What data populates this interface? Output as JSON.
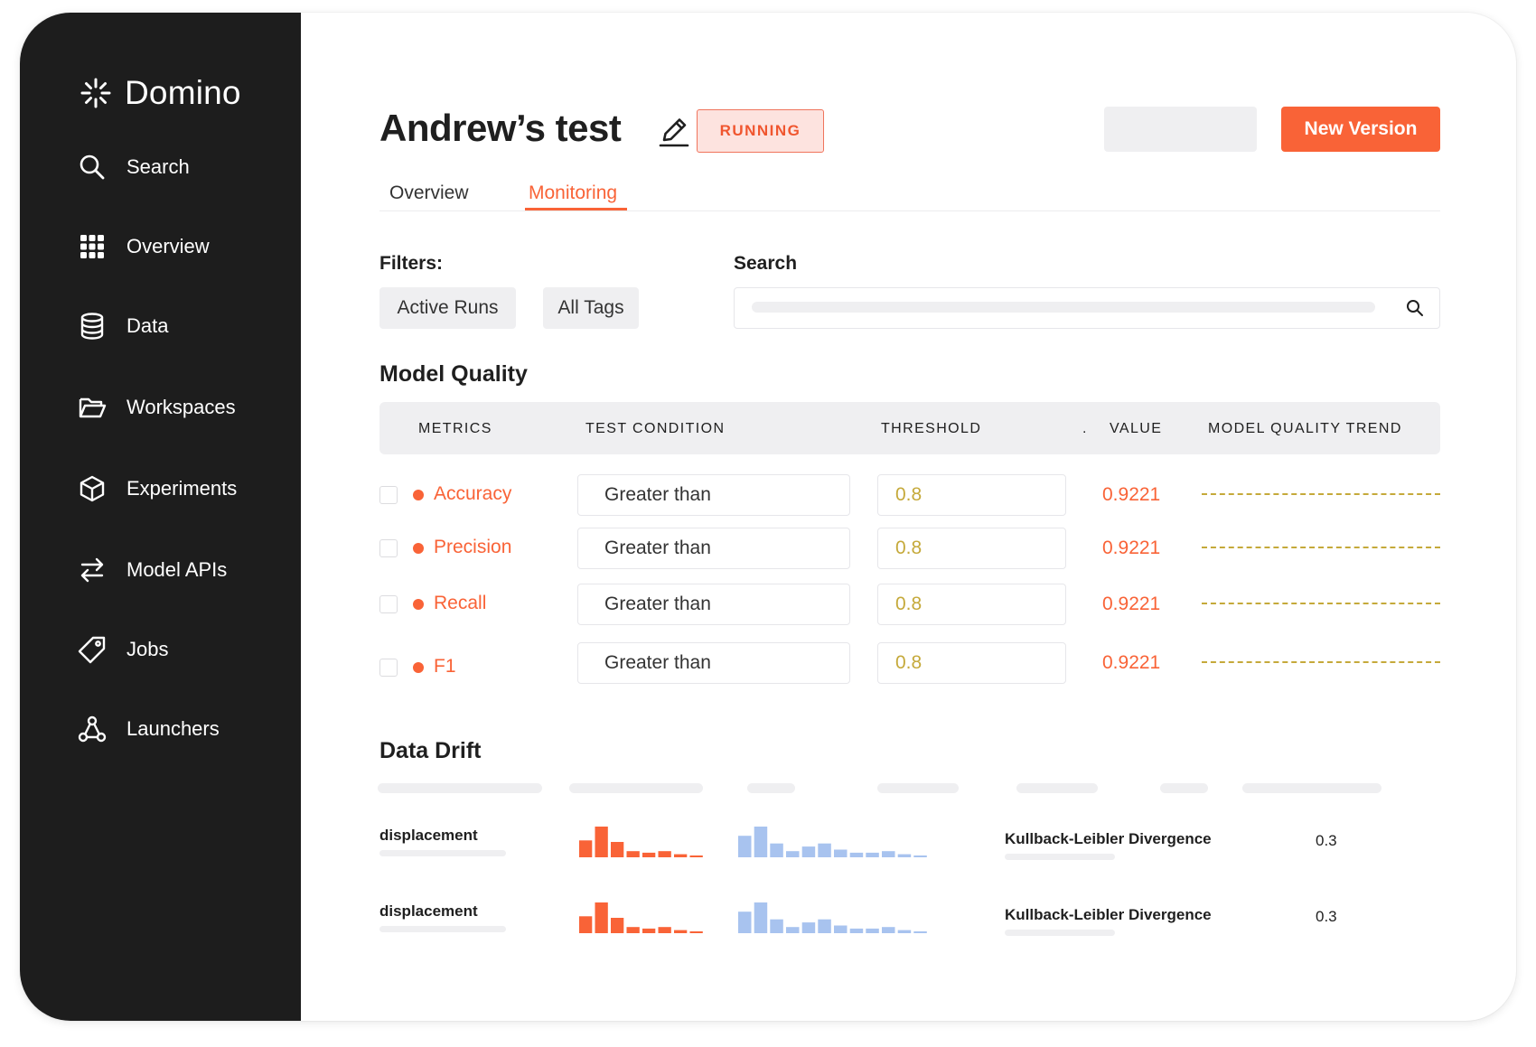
{
  "app": {
    "name": "Domino"
  },
  "sidebar": {
    "items": [
      {
        "label": "Search",
        "icon": "search-icon"
      },
      {
        "label": "Overview",
        "icon": "grid-icon"
      },
      {
        "label": "Data",
        "icon": "database-icon"
      },
      {
        "label": "Workspaces",
        "icon": "folder-icon"
      },
      {
        "label": "Experiments",
        "icon": "cube-icon"
      },
      {
        "label": "Model APIs",
        "icon": "swap-arrows-icon"
      },
      {
        "label": "Jobs",
        "icon": "tag-icon"
      },
      {
        "label": "Launchers",
        "icon": "network-icon"
      }
    ]
  },
  "header": {
    "title": "Andrew’s test",
    "status": "RUNNING",
    "new_version_label": "New Version"
  },
  "tabs": [
    {
      "label": "Overview",
      "active": false
    },
    {
      "label": "Monitoring",
      "active": true
    }
  ],
  "filters": {
    "label": "Filters:",
    "chips": [
      "Active Runs",
      "All Tags"
    ]
  },
  "search": {
    "label": "Search"
  },
  "model_quality": {
    "title": "Model Quality",
    "columns": [
      "METRICS",
      "TEST CONDITION",
      "THRESHOLD",
      ".",
      "VALUE",
      "MODEL QUALITY TREND"
    ],
    "rows": [
      {
        "metric": "Accuracy",
        "condition": "Greater than",
        "threshold": "0.8",
        "value": "0.9221"
      },
      {
        "metric": "Precision",
        "condition": "Greater than",
        "threshold": "0.8",
        "value": "0.9221"
      },
      {
        "metric": "Recall",
        "condition": "Greater than",
        "threshold": "0.8",
        "value": "0.9221"
      },
      {
        "metric": "F1",
        "condition": "Greater than",
        "threshold": "0.8",
        "value": "0.9221"
      }
    ]
  },
  "data_drift": {
    "title": "Data Drift",
    "rows": [
      {
        "feature": "displacement",
        "method": "Kullback-Leibler Divergence",
        "value": "0.3",
        "train_hist": [
          0.55,
          1.0,
          0.5,
          0.2,
          0.15,
          0.2,
          0.1,
          0.05
        ],
        "pred_hist": [
          0.7,
          1.0,
          0.45,
          0.2,
          0.35,
          0.45,
          0.25,
          0.15,
          0.15,
          0.2,
          0.1,
          0.05
        ]
      },
      {
        "feature": "displacement",
        "method": "Kullback-Leibler Divergence",
        "value": "0.3",
        "train_hist": [
          0.55,
          1.0,
          0.5,
          0.2,
          0.15,
          0.2,
          0.1,
          0.05
        ],
        "pred_hist": [
          0.7,
          1.0,
          0.45,
          0.2,
          0.35,
          0.45,
          0.25,
          0.15,
          0.15,
          0.2,
          0.1,
          0.05
        ]
      }
    ]
  },
  "colors": {
    "accent": "#f96337",
    "sidebar_bg": "#1d1d1d",
    "threshold": "#c5a93a",
    "hist_train": "#f96337",
    "hist_pred": "#a8c3ef"
  }
}
